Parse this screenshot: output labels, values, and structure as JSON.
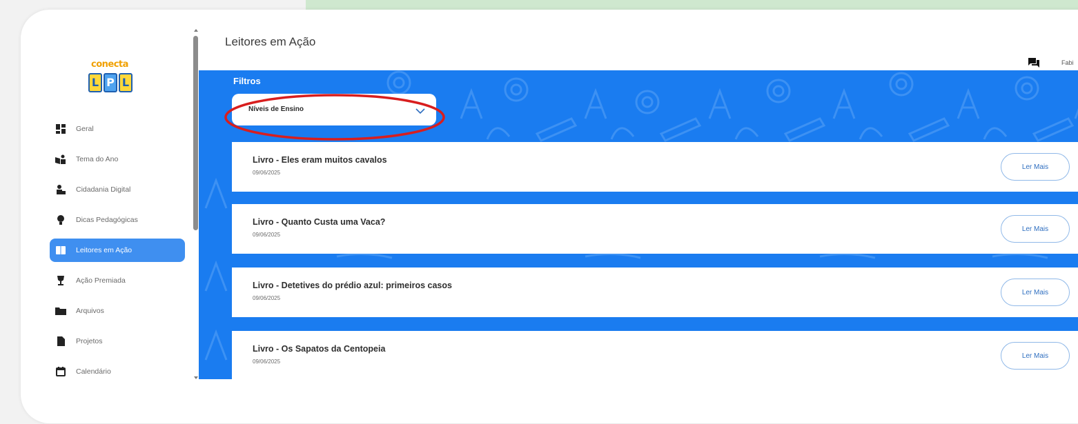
{
  "brand": {
    "logo_top": "conecta",
    "logo_tiles": [
      "L",
      "P",
      "L"
    ]
  },
  "page": {
    "title": "Leitores em Ação"
  },
  "header": {
    "user_name": "Fabi"
  },
  "sidebar": {
    "items": [
      {
        "label": "Geral",
        "icon": "dashboard-icon",
        "active": false
      },
      {
        "label": "Tema do Ano",
        "icon": "book-reader-icon",
        "active": false
      },
      {
        "label": "Cidadania Digital",
        "icon": "users-icon",
        "active": false
      },
      {
        "label": "Dicas Pedagógicas",
        "icon": "lightbulb-icon",
        "active": false
      },
      {
        "label": "Leitores em Ação",
        "icon": "book-icon",
        "active": true
      },
      {
        "label": "Ação Premiada",
        "icon": "trophy-icon",
        "active": false
      },
      {
        "label": "Arquivos",
        "icon": "folder-icon",
        "active": false
      },
      {
        "label": "Projetos",
        "icon": "file-icon",
        "active": false
      },
      {
        "label": "Calendário",
        "icon": "calendar-icon",
        "active": false
      }
    ]
  },
  "filters": {
    "label": "Filtros",
    "select_value": "Níveis de Ensino"
  },
  "books": [
    {
      "title": "Livro - Eles eram muitos cavalos",
      "date": "09/06/2025",
      "button": "Ler Mais"
    },
    {
      "title": "Livro - Quanto Custa uma Vaca?",
      "date": "09/06/2025",
      "button": "Ler Mais"
    },
    {
      "title": "Livro - Detetives do prédio azul: primeiros casos",
      "date": "09/06/2025",
      "button": "Ler Mais"
    },
    {
      "title": "Livro - Os Sapatos da Centopeia",
      "date": "09/06/2025",
      "button": "Ler Mais"
    }
  ],
  "colors": {
    "primary_blue": "#1a7cf0",
    "active_nav": "#3f8ff0",
    "highlight_red": "#d81e1e",
    "top_band": "#cfe8cf"
  }
}
